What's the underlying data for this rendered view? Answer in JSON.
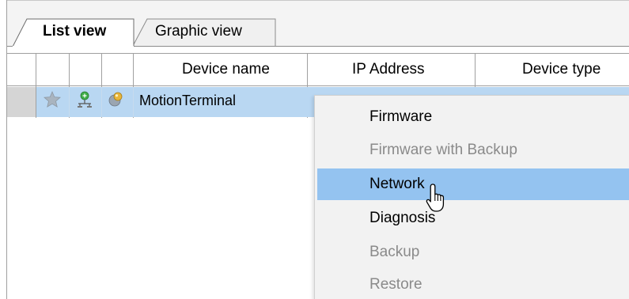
{
  "tabs": [
    {
      "label": "List view",
      "active": true
    },
    {
      "label": "Graphic view",
      "active": false
    }
  ],
  "table": {
    "columns": [
      "Device name",
      "IP Address",
      "Device type"
    ],
    "rows": [
      {
        "device_name": "MotionTerminal",
        "selected": true,
        "icons": [
          "star-icon",
          "network-connection-icon",
          "device-status-icon"
        ]
      }
    ]
  },
  "context_menu": {
    "items": [
      {
        "label": "Firmware",
        "enabled": true,
        "highlighted": false
      },
      {
        "label": "Firmware with Backup",
        "enabled": false,
        "highlighted": false
      },
      {
        "label": "Network",
        "enabled": true,
        "highlighted": true
      },
      {
        "label": "Diagnosis",
        "enabled": true,
        "highlighted": false
      },
      {
        "label": "Backup",
        "enabled": false,
        "highlighted": false
      },
      {
        "label": "Restore",
        "enabled": false,
        "highlighted": false
      }
    ]
  },
  "colors": {
    "selected_row": "#b9d7f2",
    "menu_highlight": "#94c3f0",
    "menu_background": "#f2f2f2",
    "disabled_text": "#8a8a8a"
  }
}
